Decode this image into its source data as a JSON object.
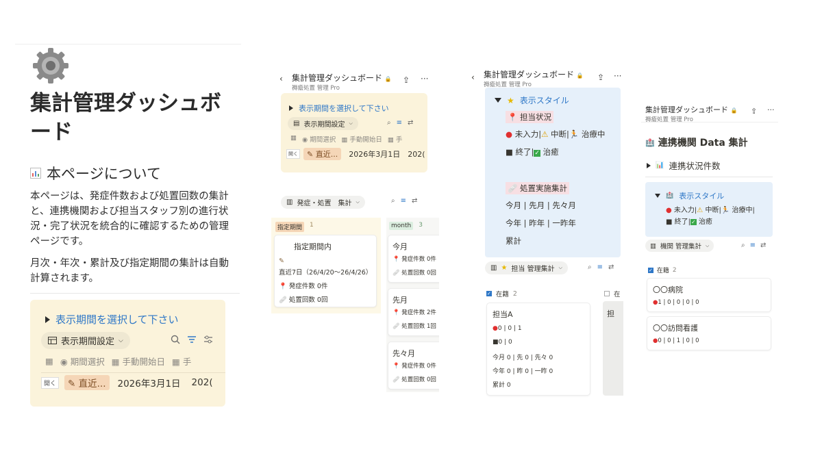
{
  "panel1": {
    "title": "集計管理ダッシュボード",
    "section_heading": "本ページについて",
    "paragraph1": "本ページは、発症件数および処置回数の集計と、連携機関および担当スタッフ別の進行状況・完了状況を統合的に確認するための管理ページです。",
    "paragraph2": "月次・年次・累計及び指定期間の集計は自動計算されます。",
    "callout_toggle": "表示期間を選択して下さい",
    "view_label": "表示期間設定",
    "col_period": "期間選択",
    "col_start": "手動開始日",
    "col_cut": "手",
    "row_open": "開く",
    "row_tag": "直近...",
    "row_date": "2026年3月1日",
    "row_cut": "202("
  },
  "panel2": {
    "title": "集計管理ダッシュボード",
    "subtitle": "褥瘡処置 管理 Pro",
    "callout_toggle": "表示期間を選択して下さい",
    "view_label": "表示期間設定",
    "col_period": "期間選択",
    "col_start": "手動開始日",
    "col_cut": "手",
    "row_open": "開く",
    "row_tag": "直近...",
    "row_date": "2026年3月1日",
    "row_cut": "202(",
    "board_label": "発症・処置　集計",
    "group1_label": "指定期間",
    "group1_count": "1",
    "group2_label": "month",
    "group2_count": "3",
    "card1": {
      "title": "指定期間内",
      "range": "直近7日（26/4/20〜26/4/26）",
      "onset": "発症件数 0件",
      "treat": "処置回数 0回"
    },
    "card2": {
      "title": "今月",
      "onset": "発症件数 0件",
      "treat": "処置回数 0回"
    },
    "card3": {
      "title": "先月",
      "onset": "発症件数 2件",
      "treat": "処置回数 1回"
    },
    "card4": {
      "title": "先々月",
      "onset": "発症件数 0件",
      "treat": "処置回数 0回"
    }
  },
  "panel3": {
    "title": "集計管理ダッシュボード",
    "subtitle": "褥瘡処置 管理 Pro",
    "toggle": "表示スタイル",
    "status_heading": "担当状況",
    "status_line1": "未入力|",
    "status_line1b": "中断|",
    "status_line1c": "治療中",
    "status_line2": "終了|",
    "status_line2b": "治癒",
    "treat_heading": "処置実施集計",
    "period1": "今月 | 先月 | 先々月",
    "period2": "今年 | 昨年 | 一昨年",
    "period3": "累計",
    "board_label": "担当 管理集計",
    "group_label": "在籍",
    "group_count": "2",
    "group2_label": "在",
    "card_title": "担当A",
    "card_row1": "0 |  0 |  1",
    "card_row2": "0 |  0",
    "card_row3": "今月 0 | 先 0 | 先々 0",
    "card_row4": "今年 0 | 昨 0 | 一昨 0",
    "card_row5": "累計 0",
    "card2_cut": "担"
  },
  "panel4": {
    "title": "集計管理ダッシュボード",
    "subtitle": "褥瘡処置 管理 Pro",
    "heading": "連携機関 Data 集計",
    "toggle1": "連携状況件数",
    "toggle2": "表示スタイル",
    "legend1": "未入力|",
    "legend1b": "中断|",
    "legend1c": "治療中|",
    "legend2": "終了|",
    "legend2b": "治癒",
    "board_label": "機関 管理集計",
    "group_label": "在籍",
    "group_count": "2",
    "card1_title": "〇〇病院",
    "card1_row": "1 |  0 |  0 |  0 |  0",
    "card2_title": "〇〇訪問看護",
    "card2_row": "0 |  0 |  1 |  0 |  0"
  },
  "colors": {
    "callout_yellow": "#fbf3db",
    "callout_blue": "#e6f0fa",
    "link_blue": "#2e77c7",
    "tag_orange": "#f5d6b7",
    "tag_green": "#dbeee0"
  }
}
